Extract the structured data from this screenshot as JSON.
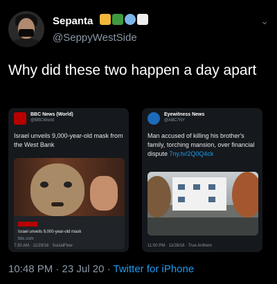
{
  "user": {
    "display_name": "Sepanta",
    "emojis": [
      "house-emoji",
      "palm-tree-emoji",
      "face-emoji",
      "white-square-emoji"
    ],
    "handle": "@SeppyWestSide"
  },
  "tweet": {
    "text": "Why did these two happen a day apart"
  },
  "embedded_tweets": [
    {
      "source_name": "BBC News (World)",
      "source_handle": "@BBCWorld",
      "text": "Israel unveils 9,000-year-old mask from the West Bank",
      "media_caption": "Israel unveils 9,000-year-old mask",
      "media_domain": "bbc.com",
      "timestamp": "7:30 AM · 11/29/18 · SocialFlow"
    },
    {
      "source_name": "Eyewitness News",
      "source_handle": "@ABC7NY",
      "text": "Man accused of killing his brother's family, torching mansion, over financial dispute",
      "link": "7ny.tv/2Q0Q4ck",
      "timestamp": "11:00 PM · 11/28/18 · True Anthem"
    }
  ],
  "footer": {
    "time_date": "10:48 PM · 23 Jul 20 · ",
    "app": "Twitter for iPhone"
  },
  "colors": {
    "background": "#000000",
    "accent": "#1d9bf0",
    "bbc_red": "#b80000"
  }
}
